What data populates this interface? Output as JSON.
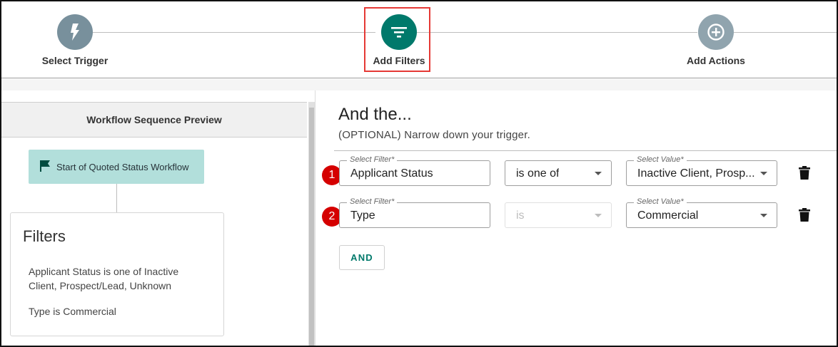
{
  "stepper": {
    "steps": [
      {
        "label": "Select Trigger",
        "icon": "lightning-bolt-icon",
        "color": "#78909c"
      },
      {
        "label": "Add Filters",
        "icon": "filter-icon",
        "color": "#00796b",
        "active": true
      },
      {
        "label": "Add Actions",
        "icon": "plus-circle-icon",
        "color": "#90a4ae"
      }
    ]
  },
  "preview": {
    "title": "Workflow Sequence Preview",
    "start_node": "Start of Quoted Status Workflow",
    "filters_card": {
      "title": "Filters",
      "lines": [
        "Applicant Status is one of Inactive Client, Prospect/Lead, Unknown",
        "Type is Commercial"
      ]
    }
  },
  "main": {
    "title": "And the...",
    "subtitle": "(OPTIONAL) Narrow down your trigger.",
    "filter_rows": [
      {
        "badge": "1",
        "filter_legend": "Select Filter*",
        "filter_value": "Applicant Status",
        "operator": "is one of",
        "operator_disabled": false,
        "value_legend": "Select Value*",
        "value": "Inactive Client, Prosp..."
      },
      {
        "badge": "2",
        "filter_legend": "Select Filter*",
        "filter_value": "Type",
        "operator": "is",
        "operator_disabled": true,
        "value_legend": "Select Value*",
        "value": "Commercial"
      }
    ],
    "and_button": "AND"
  },
  "colors": {
    "accent": "#00796b",
    "highlight": "#e53935",
    "badge": "#d50000"
  }
}
